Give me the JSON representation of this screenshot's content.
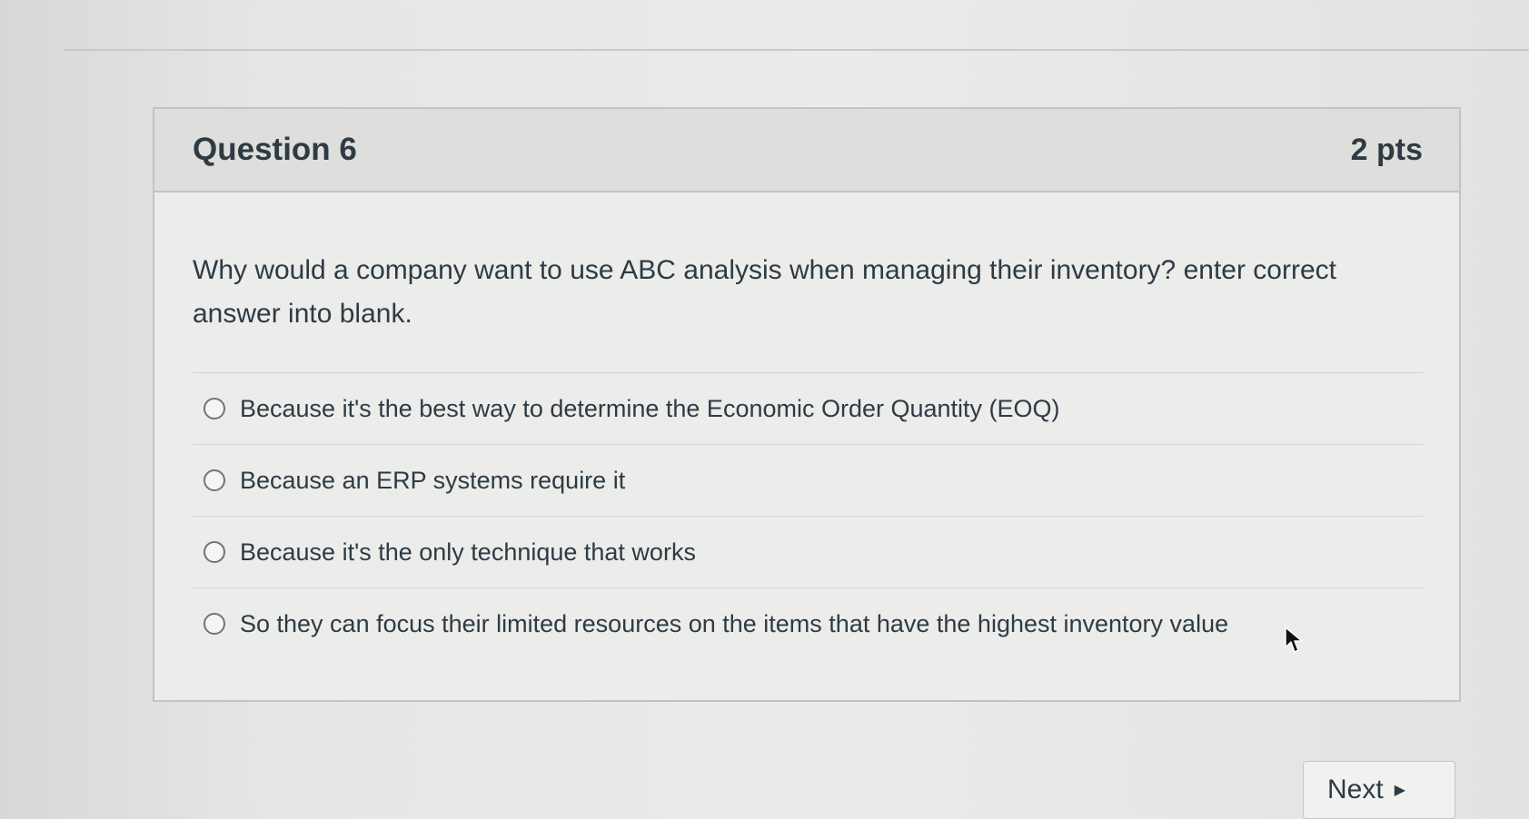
{
  "question": {
    "title": "Question 6",
    "points": "2 pts",
    "text": "Why would a company want to use ABC analysis when managing their inventory? enter correct answer into blank.",
    "answers": [
      {
        "label": "Because it's the best way to determine the Economic Order Quantity (EOQ)"
      },
      {
        "label": "Because an ERP systems require it"
      },
      {
        "label": "Because it's the only technique that works"
      },
      {
        "label": "So they can focus their limited resources on the items that have the highest inventory value"
      }
    ]
  },
  "navigation": {
    "next_label": "Next",
    "next_icon": "triangle-right-icon"
  },
  "cursor": {
    "icon": "mouse-pointer-icon"
  }
}
